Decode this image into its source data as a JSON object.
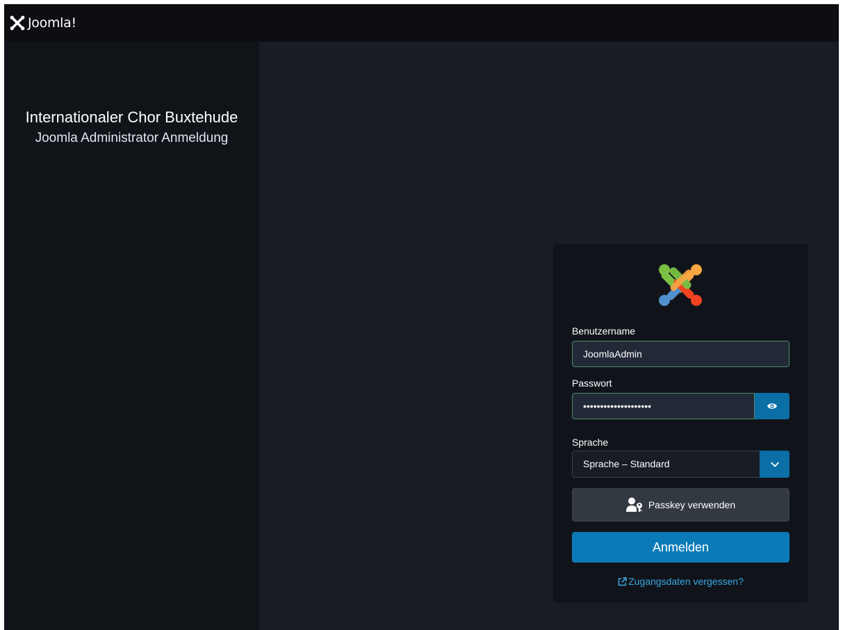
{
  "header": {
    "brand_name": "Joomla!",
    "brand_icon": "joomla-logo-icon"
  },
  "sidebar": {
    "site_name": "Internationaler Chor Buxtehude",
    "page_title": "Joomla Administrator Anmeldung"
  },
  "login_form": {
    "logo_icon": "joomla-logo-icon",
    "username": {
      "label": "Benutzername",
      "value": "JoomlaAdmin"
    },
    "password": {
      "label": "Passwort",
      "value": "••••••••••••••••••••",
      "toggle_icon": "eye-icon"
    },
    "language": {
      "label": "Sprache",
      "selected": "Sprache – Standard",
      "caret_icon": "chevron-down-icon"
    },
    "passkey_button": {
      "label": "Passkey verwenden",
      "icon": "user-key-icon"
    },
    "submit_label": "Anmelden",
    "forgot_link": {
      "label": "Zugangsdaten vergessen?",
      "icon": "external-link-icon"
    }
  },
  "colors": {
    "primary": "#0b7bb8",
    "link": "#3aa7e0",
    "background": "#181c24",
    "sidebar": "#101419"
  }
}
